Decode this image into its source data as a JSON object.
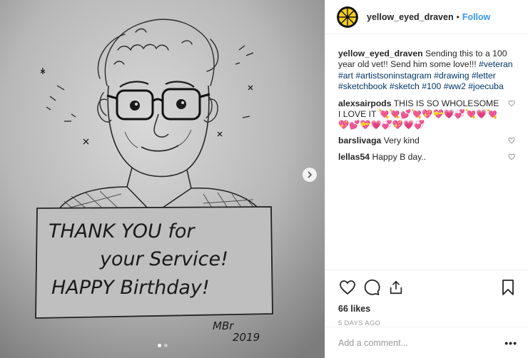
{
  "post": {
    "username": "yellow_eyed_draven",
    "separator": "•",
    "follow_label": "Follow",
    "caption_text": "Sending this to a 100 year old vet!! Send him some love!!!",
    "hashtags": "#veteran #art #artistsoninstagram #drawing #letter #sketchbook #sketch #100 #ww2 #joecuba"
  },
  "drawing": {
    "sign_line1": "THANK YOU for",
    "sign_line2": "your Service!",
    "sign_line3": "HAPPY Birthday!",
    "signature": "MBr",
    "year": "2019"
  },
  "comments": [
    {
      "user": "alexsairpods",
      "text": "THIS IS SO WHOLESOME I LOVE IT",
      "emoji": "💘💘💕💘💖💝💗💞💘💗💘💖💕💝💗💞💖💗💞"
    },
    {
      "user": "barslivaga",
      "text": "Very kind",
      "emoji": ""
    },
    {
      "user": "lellas54",
      "text": "Happy B day..",
      "emoji": ""
    }
  ],
  "meta": {
    "likes": "66 likes",
    "time": "5 DAYS AGO",
    "comment_placeholder": "Add a comment...",
    "more_label": "•••"
  },
  "icons": {
    "heart": "heart-icon",
    "comment": "comment-icon",
    "share": "share-icon",
    "bookmark": "bookmark-icon",
    "like_small": "heart-outline-icon",
    "next": "chevron-right-icon",
    "avatar": "lemon-slice-icon"
  },
  "colors": {
    "accent": "#3897f0",
    "hashtag": "#003569",
    "avatar_yellow": "#f5d020"
  },
  "carousel": {
    "count": 2,
    "active": 0
  }
}
